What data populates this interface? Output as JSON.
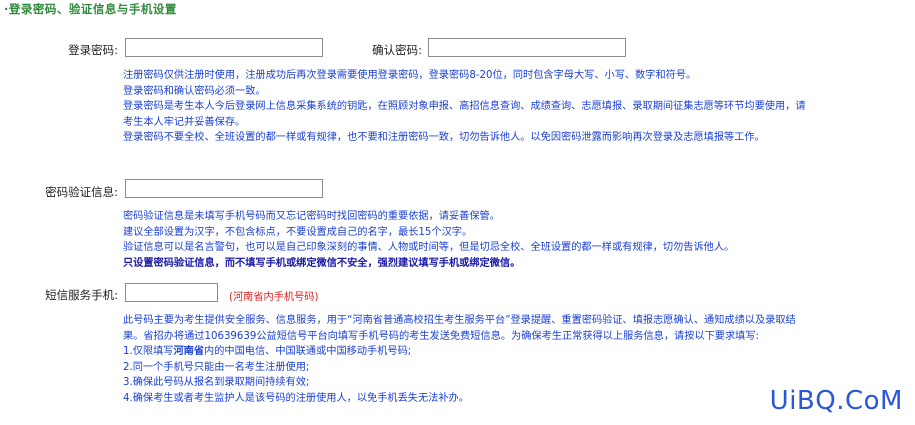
{
  "section": {
    "title": "·登录密码、验证信息与手机设置"
  },
  "password": {
    "label": "登录密码:",
    "value": "",
    "confirm_label": "确认密码:",
    "confirm_value": "",
    "notes": [
      "注册密码仅供注册时使用，注册成功后再次登录需要使用登录密码，登录密码8-20位，同时包含字母大写、小写、数字和符号。",
      "登录密码和确认密码必须一致。",
      "登录密码是考生本人今后登录网上信息采集系统的钥匙，在照顾对象申报、高招信息查询、成绩查询、志愿填报、录取期间征集志愿等环节均要使用，请",
      "考生本人牢记并妥善保存。",
      "登录密码不要全校、全班设置的都一样或有规律，也不要和注册密码一致，切勿告诉他人。以免因密码泄露而影响再次登录及志愿填报等工作。"
    ]
  },
  "verify": {
    "label": "密码验证信息:",
    "value": "",
    "notes": [
      "密码验证信息是未填写手机号码而又忘记密码时找回密码的重要依据，请妥善保管。",
      "建议全部设置为汉字，不包含标点，不要设置成自己的名字，最长15个汉字。",
      "验证信息可以是名言警句，也可以是自己印象深刻的事情、人物或时间等，但是切忌全校、全班设置的都一样或有规律，切勿告诉他人。"
    ],
    "bold_note": "只设置密码验证信息，而不填写手机或绑定微信不安全，强烈建议填写手机或绑定微信。"
  },
  "phone": {
    "label": "短信服务手机:",
    "value": "",
    "hint": "(河南省内手机号码)",
    "notes": [
      "此号码主要为考生提供安全服务、信息服务，用于“河南省普通高校招生考生服务平台”登录提醒、重置密码验证、填报志愿确认、通知成绩以及录取结",
      "果。省招办将通过10639639公益短信号平台向填写手机号码的考生发送免费短信息。为确保考生正常获得以上服务信息，请按以下要求填写:"
    ],
    "rule1_prefix": "1.仅限填写",
    "rule1_strong": "河南省",
    "rule1_suffix": "内的中国电信、中国联通或中国移动手机号码;",
    "rule2": "2.同一个手机号只能由一名考生注册使用;",
    "rule3": "3.确保此号码从报名到录取期间持续有效;",
    "rule4": "4.确保考生或者考生监护人是该号码的注册使用人，以免手机丢失无法补办。"
  },
  "watermark": {
    "text": "UiBQ.CoM"
  }
}
